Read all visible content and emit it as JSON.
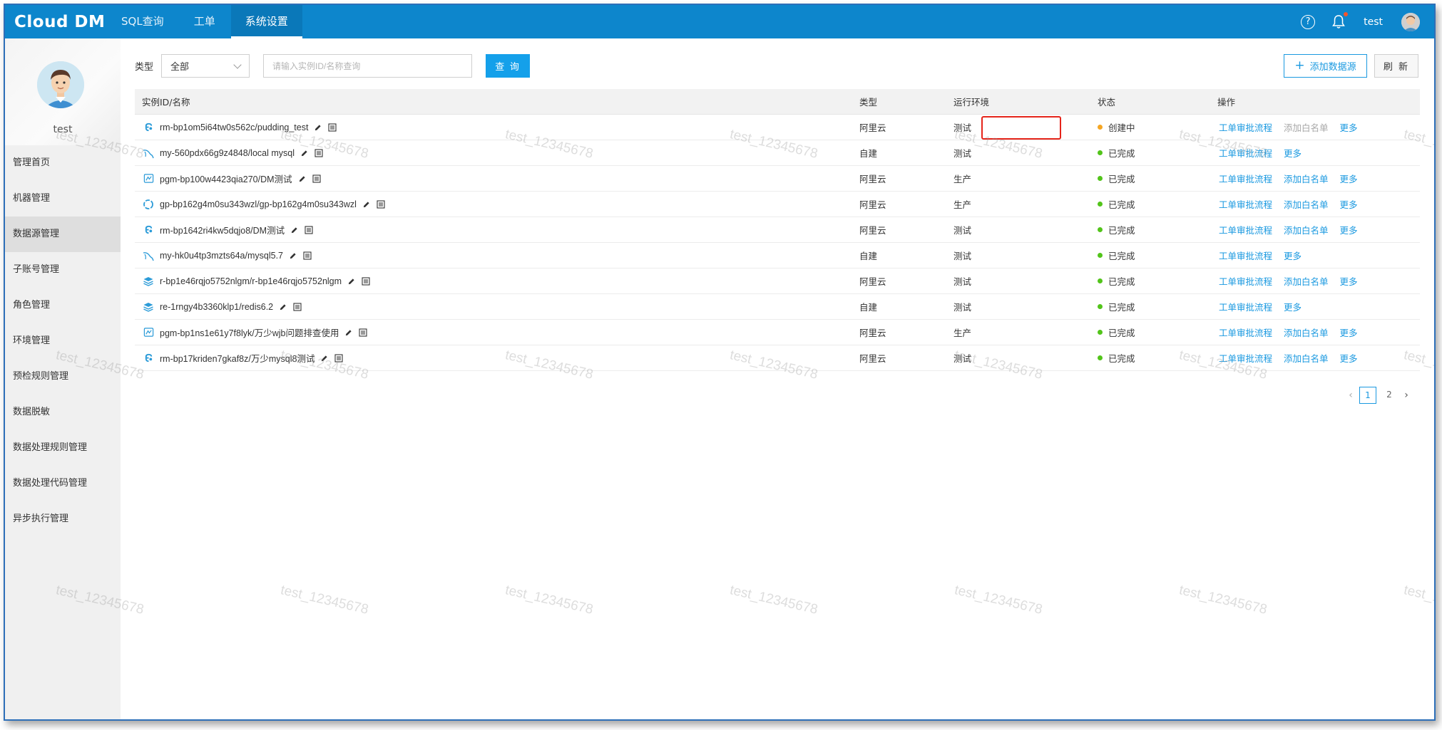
{
  "app": {
    "logo": "Cloud DM"
  },
  "topnav": {
    "tabs": [
      {
        "label": "SQL查询",
        "active": false
      },
      {
        "label": "工单",
        "active": false
      },
      {
        "label": "系统设置",
        "active": true
      }
    ],
    "help_glyph": "?",
    "username": "test",
    "icons": {
      "help": "help-circle-icon",
      "notifications": "bell-icon",
      "avatar": "user-avatar"
    }
  },
  "sidebar": {
    "profile_name": "test",
    "items": [
      {
        "label": "管理首页",
        "active": false
      },
      {
        "label": "机器管理",
        "active": false
      },
      {
        "label": "数据源管理",
        "active": true
      },
      {
        "label": "子账号管理",
        "active": false
      },
      {
        "label": "角色管理",
        "active": false
      },
      {
        "label": "环境管理",
        "active": false
      },
      {
        "label": "预检规则管理",
        "active": false
      },
      {
        "label": "数据脱敏",
        "active": false
      },
      {
        "label": "数据处理规则管理",
        "active": false
      },
      {
        "label": "数据处理代码管理",
        "active": false
      },
      {
        "label": "异步执行管理",
        "active": false
      }
    ]
  },
  "filter": {
    "type_label": "类型",
    "type_value": "全部",
    "search_placeholder": "请输入实例ID/名称查询",
    "query_button": "查 询",
    "add_button": "添加数据源",
    "refresh_button": "刷 新"
  },
  "table": {
    "headers": {
      "name": "实例ID/名称",
      "type": "类型",
      "env": "运行环境",
      "status": "状态",
      "ops": "操作"
    },
    "rows": [
      {
        "icon": "aliyun-rds-icon",
        "name": "rm-bp1om5i64tw0s562c/pudding_test",
        "type": "阿里云",
        "env": "测试",
        "status": "创建中",
        "status_color": "#f5a623",
        "op1": "工单审批流程",
        "op2": "添加白名单",
        "op2_disabled": true,
        "more": "更多"
      },
      {
        "icon": "mysql-icon",
        "name": "my-560pdx66g9z4848/local mysql",
        "type": "自建",
        "env": "测试",
        "status": "已完成",
        "status_color": "#52c41a",
        "op1": "工单审批流程",
        "op2": "",
        "op2_disabled": false,
        "more": "更多"
      },
      {
        "icon": "postgresql-icon",
        "name": "pgm-bp100w4423qia270/DM测试",
        "type": "阿里云",
        "env": "生产",
        "status": "已完成",
        "status_color": "#52c41a",
        "op1": "工单审批流程",
        "op2": "添加白名单",
        "op2_disabled": false,
        "more": "更多"
      },
      {
        "icon": "greenplum-icon",
        "name": "gp-bp162g4m0su343wzl/gp-bp162g4m0su343wzl",
        "type": "阿里云",
        "env": "生产",
        "status": "已完成",
        "status_color": "#52c41a",
        "op1": "工单审批流程",
        "op2": "添加白名单",
        "op2_disabled": false,
        "more": "更多"
      },
      {
        "icon": "aliyun-rds-icon",
        "name": "rm-bp1642ri4kw5dqjo8/DM测试",
        "type": "阿里云",
        "env": "测试",
        "status": "已完成",
        "status_color": "#52c41a",
        "op1": "工单审批流程",
        "op2": "添加白名单",
        "op2_disabled": false,
        "more": "更多"
      },
      {
        "icon": "mysql-icon",
        "name": "my-hk0u4tp3mzts64a/mysql5.7",
        "type": "自建",
        "env": "测试",
        "status": "已完成",
        "status_color": "#52c41a",
        "op1": "工单审批流程",
        "op2": "",
        "op2_disabled": false,
        "more": "更多"
      },
      {
        "icon": "redis-icon",
        "name": "r-bp1e46rqjo5752nlgm/r-bp1e46rqjo5752nlgm",
        "type": "阿里云",
        "env": "测试",
        "status": "已完成",
        "status_color": "#52c41a",
        "op1": "工单审批流程",
        "op2": "添加白名单",
        "op2_disabled": false,
        "more": "更多"
      },
      {
        "icon": "redis-icon",
        "name": "re-1rngy4b3360klp1/redis6.2",
        "type": "自建",
        "env": "测试",
        "status": "已完成",
        "status_color": "#52c41a",
        "op1": "工单审批流程",
        "op2": "",
        "op2_disabled": false,
        "more": "更多"
      },
      {
        "icon": "postgresql-icon",
        "name": "pgm-bp1ns1e61y7f8lyk/万少wjb问题排查使用",
        "type": "阿里云",
        "env": "生产",
        "status": "已完成",
        "status_color": "#52c41a",
        "op1": "工单审批流程",
        "op2": "添加白名单",
        "op2_disabled": false,
        "more": "更多"
      },
      {
        "icon": "aliyun-rds-icon",
        "name": "rm-bp17kriden7gkaf8z/万少mysql8测试",
        "type": "阿里云",
        "env": "测试",
        "status": "已完成",
        "status_color": "#52c41a",
        "op1": "工单审批流程",
        "op2": "添加白名单",
        "op2_disabled": false,
        "more": "更多"
      }
    ]
  },
  "pagination": {
    "pages": [
      "1",
      "2"
    ],
    "current": "1"
  },
  "watermark": "test_12345678",
  "colors": {
    "topbar": "#0d86cc",
    "accent": "#1a99e0",
    "creating": "#f5a623",
    "done": "#52c41a",
    "highlight": "#e5241a"
  }
}
